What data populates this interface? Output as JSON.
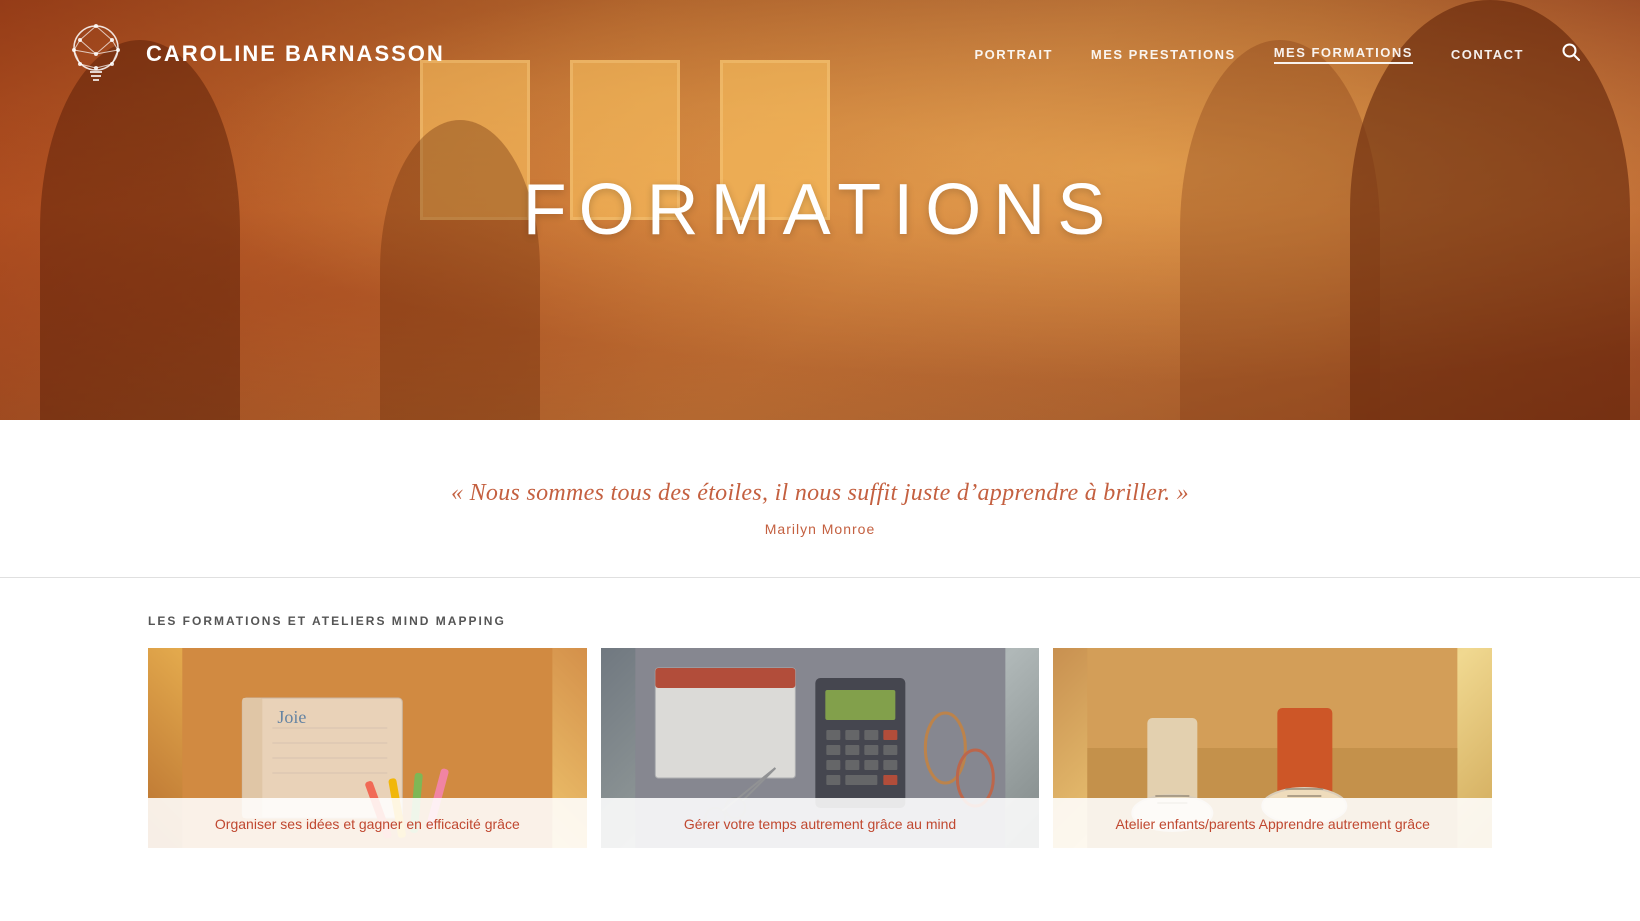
{
  "site": {
    "logo_text": "CAROLINE BARNASSON",
    "title": "FORMATIONS"
  },
  "nav": {
    "items": [
      {
        "id": "portrait",
        "label": "PORTRAIT",
        "active": false
      },
      {
        "id": "mes-prestations",
        "label": "MES PRESTATIONS",
        "active": false
      },
      {
        "id": "mes-formations",
        "label": "MES FORMATIONS",
        "active": true
      },
      {
        "id": "contact",
        "label": "CONTACT",
        "active": false
      }
    ]
  },
  "quote": {
    "text": "« Nous sommes tous des étoiles, il nous suffit juste d’apprendre à briller. »",
    "author": "Marilyn Monroe"
  },
  "section": {
    "formations_label": "LES FORMATIONS ET ATELIERS MIND MAPPING"
  },
  "cards": [
    {
      "id": "card-1",
      "caption": "Organiser ses idées et gagner en efficacité grâce"
    },
    {
      "id": "card-2",
      "caption": "Gérer votre temps autrement grâce au mind"
    },
    {
      "id": "card-3",
      "caption": "Atelier enfants/parents Apprendre autrement grâce"
    }
  ]
}
